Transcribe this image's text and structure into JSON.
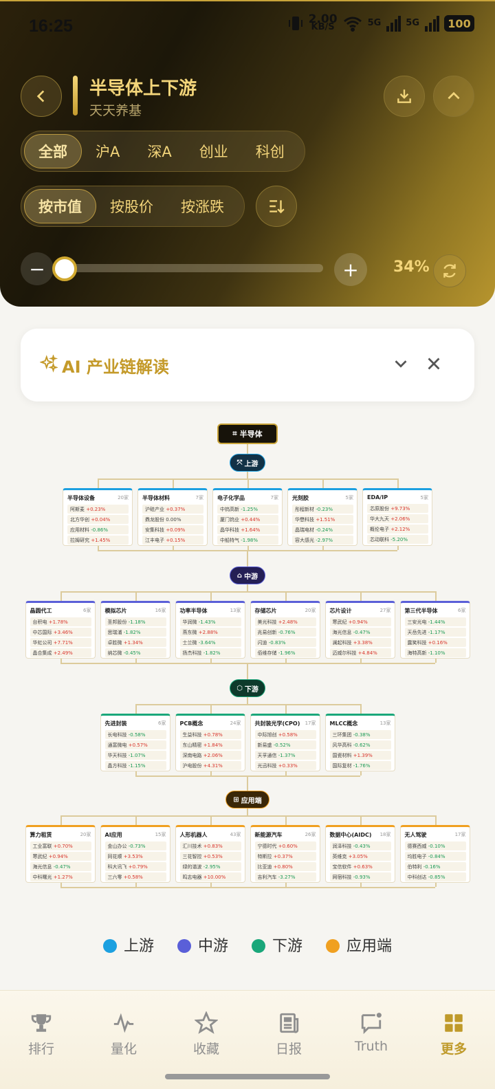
{
  "status": {
    "time": "16:25",
    "speed": "2.00",
    "speed_unit": "KB/S",
    "net1": "5G",
    "net2": "5G",
    "battery": "100"
  },
  "header": {
    "title": "半导体上下游",
    "subtitle": "天天养基"
  },
  "markets": {
    "items": [
      "全部",
      "沪A",
      "深A",
      "创业",
      "科创"
    ],
    "selected": 0
  },
  "sorts": {
    "items": [
      "按市值",
      "按股价",
      "按涨跌"
    ],
    "selected": 0
  },
  "zoom": {
    "percent_label": "34%",
    "value": 0.34,
    "minus": "−",
    "plus": "+"
  },
  "ai_panel": {
    "title": "AI 产业链解读"
  },
  "chart_data": {
    "type": "tree",
    "root": "半导体",
    "stages": [
      {
        "name": "上游",
        "color": "#1ca0e0",
        "groups": [
          {
            "name": "半导体设备",
            "count": "20家",
            "stocks": [
              [
                "阿斯麦",
                "+0.23%"
              ],
              [
                "北方华创",
                "+0.04%"
              ],
              [
                "应用材料",
                "-0.86%"
              ],
              [
                "拉姆研究",
                "+1.45%"
              ]
            ]
          },
          {
            "name": "半导体材料",
            "count": "7家",
            "stocks": [
              [
                "沪硅产业",
                "+0.37%"
              ],
              [
                "鼎龙股份",
                "0.00%"
              ],
              [
                "安集科技",
                "+0.09%"
              ],
              [
                "江丰电子",
                "+0.15%"
              ]
            ]
          },
          {
            "name": "电子化学品",
            "count": "7家",
            "stocks": [
              [
                "中钨高新",
                "-1.25%"
              ],
              [
                "厦门钨业",
                "+0.44%"
              ],
              [
                "晶华科技",
                "+1.64%"
              ],
              [
                "中船特气",
                "-1.98%"
              ]
            ]
          },
          {
            "name": "光刻胶",
            "count": "5家",
            "stocks": [
              [
                "彤程新材",
                "-0.23%"
              ],
              [
                "华懋科技",
                "+1.51%"
              ],
              [
                "晶瑞电材",
                "-0.24%"
              ],
              [
                "容大感光",
                "-2.97%"
              ]
            ]
          },
          {
            "name": "EDA/IP",
            "count": "5家",
            "stocks": [
              [
                "芯原股份",
                "+9.73%"
              ],
              [
                "华大九天",
                "+2.06%"
              ],
              [
                "概伦电子",
                "+2.12%"
              ],
              [
                "芯动联科",
                "-5.20%"
              ]
            ]
          }
        ]
      },
      {
        "name": "中游",
        "color": "#5a5fd8",
        "groups": [
          {
            "name": "晶圆代工",
            "count": "6家",
            "stocks": [
              [
                "台积电",
                "+1.78%"
              ],
              [
                "中芯国际",
                "+3.46%"
              ],
              [
                "华虹公司",
                "+7.71%"
              ],
              [
                "晶合集成",
                "+2.49%"
              ]
            ]
          },
          {
            "name": "模拟芯片",
            "count": "16家",
            "stocks": [
              [
                "圣邦股份",
                "-1.18%"
              ],
              [
                "思瑞浦",
                "-1.82%"
              ],
              [
                "卓胜微",
                "+1.34%"
              ],
              [
                "纳芯微",
                "-0.45%"
              ]
            ]
          },
          {
            "name": "功率半导体",
            "count": "13家",
            "stocks": [
              [
                "华润微",
                "-1.43%"
              ],
              [
                "燕东微",
                "+2.88%"
              ],
              [
                "士兰微",
                "-3.64%"
              ],
              [
                "扬杰科技",
                "-1.82%"
              ]
            ]
          },
          {
            "name": "存储芯片",
            "count": "20家",
            "stocks": [
              [
                "美光科技",
                "+2.48%"
              ],
              [
                "兆易创新",
                "-0.76%"
              ],
              [
                "闪迪",
                "-0.83%"
              ],
              [
                "佰维存储",
                "-1.96%"
              ]
            ]
          },
          {
            "name": "芯片设计",
            "count": "27家",
            "stocks": [
              [
                "寒武纪",
                "+0.94%"
              ],
              [
                "海光信息",
                "-0.47%"
              ],
              [
                "澜起科技",
                "+3.38%"
              ],
              [
                "迈威尔科技",
                "+4.84%"
              ]
            ]
          },
          {
            "name": "第三代半导体",
            "count": "6家",
            "stocks": [
              [
                "三安光电",
                "-1.44%"
              ],
              [
                "天岳先进",
                "-1.17%"
              ],
              [
                "露笑科技",
                "+0.16%"
              ],
              [
                "海特高新",
                "-1.10%"
              ]
            ]
          }
        ]
      },
      {
        "name": "下游",
        "color": "#1aa77a",
        "groups": [
          {
            "name": "先进封装",
            "count": "6家",
            "stocks": [
              [
                "长电科技",
                "-0.58%"
              ],
              [
                "通富微电",
                "+0.57%"
              ],
              [
                "华天科技",
                "-1.07%"
              ],
              [
                "晶方科技",
                "-1.15%"
              ]
            ]
          },
          {
            "name": "PCB概念",
            "count": "24家",
            "stocks": [
              [
                "生益科技",
                "+0.78%"
              ],
              [
                "东山精密",
                "+1.84%"
              ],
              [
                "深南电路",
                "+2.06%"
              ],
              [
                "沪电股份",
                "+4.31%"
              ]
            ]
          },
          {
            "name": "共封装光学(CPO)",
            "count": "17家",
            "stocks": [
              [
                "中际旭创",
                "+0.58%"
              ],
              [
                "新易盛",
                "-0.52%"
              ],
              [
                "天孚通信",
                "-1.37%"
              ],
              [
                "光迅科技",
                "+0.33%"
              ]
            ]
          },
          {
            "name": "MLCC概念",
            "count": "13家",
            "stocks": [
              [
                "三环集团",
                "-0.38%"
              ],
              [
                "风华高科",
                "-0.62%"
              ],
              [
                "国瓷材料",
                "+1.39%"
              ],
              [
                "国际复材",
                "-1.76%"
              ]
            ]
          }
        ]
      },
      {
        "name": "应用端",
        "color": "#f0a020",
        "groups": [
          {
            "name": "算力租赁",
            "count": "20家",
            "stocks": [
              [
                "工业富联",
                "+0.70%"
              ],
              [
                "寒武纪",
                "+0.94%"
              ],
              [
                "海光信息",
                "-0.47%"
              ],
              [
                "中科曙光",
                "+1.27%"
              ]
            ]
          },
          {
            "name": "AI应用",
            "count": "15家",
            "stocks": [
              [
                "金山办公",
                "-0.73%"
              ],
              [
                "同花顺",
                "+3.53%"
              ],
              [
                "科大讯飞",
                "+0.79%"
              ],
              [
                "三六零",
                "+0.58%"
              ]
            ]
          },
          {
            "name": "人形机器人",
            "count": "43家",
            "stocks": [
              [
                "汇川技术",
                "+0.83%"
              ],
              [
                "三花智控",
                "+0.53%"
              ],
              [
                "绿的谐波",
                "-2.95%"
              ],
              [
                "鸣志电器",
                "+10.00%"
              ]
            ]
          },
          {
            "name": "新能源汽车",
            "count": "26家",
            "stocks": [
              [
                "宁德时代",
                "+0.60%"
              ],
              [
                "特斯拉",
                "+0.37%"
              ],
              [
                "比亚迪",
                "+0.80%"
              ],
              [
                "吉利汽车",
                "-3.27%"
              ]
            ]
          },
          {
            "name": "数据中心(AIDC)",
            "count": "18家",
            "stocks": [
              [
                "润泽科技",
                "-0.43%"
              ],
              [
                "英维克",
                "+3.05%"
              ],
              [
                "宝信软件",
                "+0.63%"
              ],
              [
                "网宿科技",
                "-0.93%"
              ]
            ]
          },
          {
            "name": "无人驾驶",
            "count": "17家",
            "stocks": [
              [
                "德赛西威",
                "-0.10%"
              ],
              [
                "均胜电子",
                "-0.84%"
              ],
              [
                "伯特利",
                "-0.16%"
              ],
              [
                "中科创达",
                "-0.85%"
              ]
            ]
          }
        ]
      }
    ]
  },
  "legend": [
    {
      "label": "上游",
      "color": "#1ca0e0"
    },
    {
      "label": "中游",
      "color": "#5a5fd8"
    },
    {
      "label": "下游",
      "color": "#1aa77a"
    },
    {
      "label": "应用端",
      "color": "#f0a020"
    }
  ],
  "nav": {
    "items": [
      {
        "label": "排行",
        "icon": "trophy-icon"
      },
      {
        "label": "量化",
        "icon": "pulse-icon"
      },
      {
        "label": "收藏",
        "icon": "star-icon"
      },
      {
        "label": "日报",
        "icon": "newspaper-icon"
      },
      {
        "label": "Truth",
        "icon": "message-icon"
      },
      {
        "label": "更多",
        "icon": "grid-icon"
      }
    ],
    "selected": 5
  }
}
